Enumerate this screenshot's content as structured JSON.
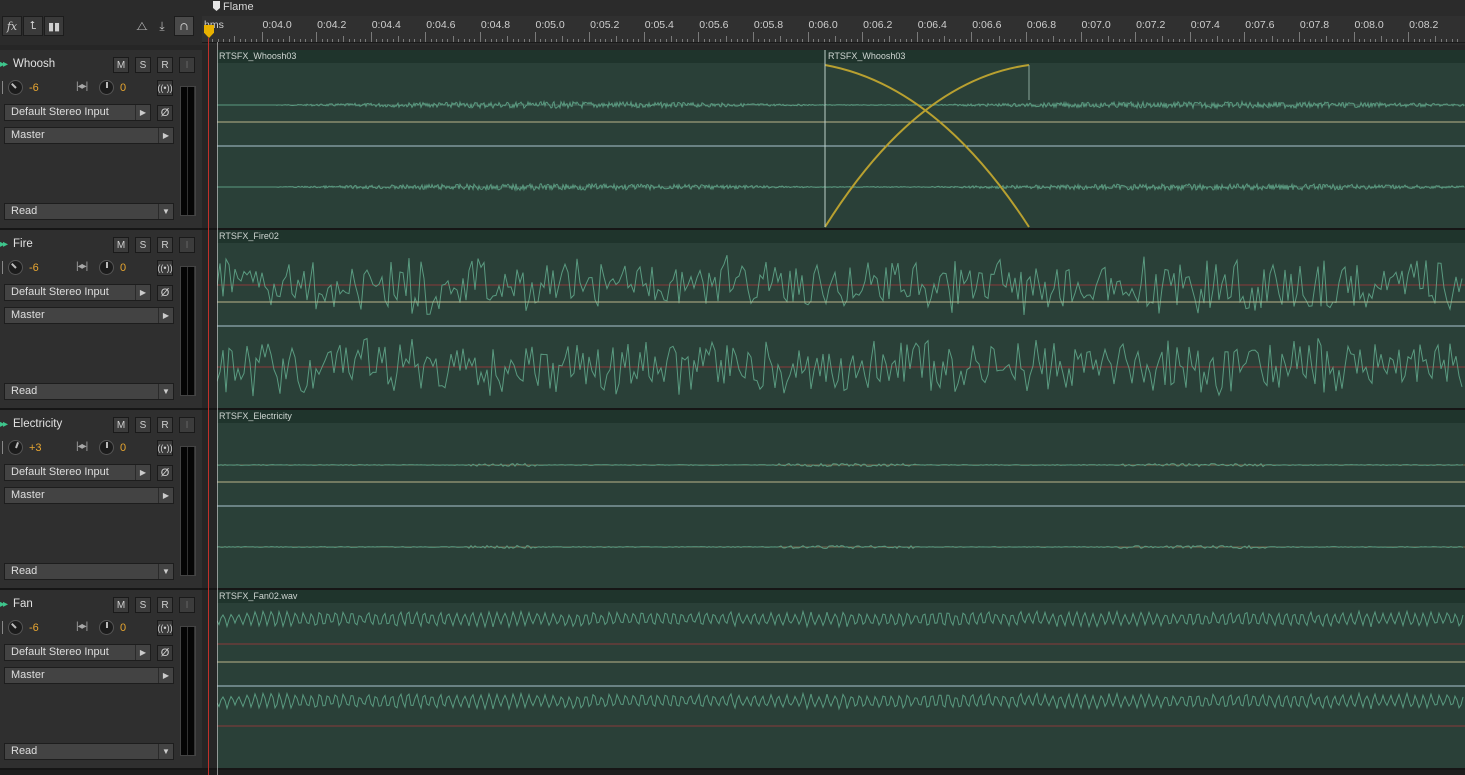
{
  "toolbar": {
    "fx_label": "fx",
    "icons": [
      "fx-button",
      "send-routing-icon",
      "eq-icon",
      "metronome-icon",
      "record-input-icon",
      "headphones-icon"
    ]
  },
  "marker": {
    "label": "Flame"
  },
  "ruler": {
    "unit_label": "hms",
    "ticks": [
      "0:04.0",
      "0:04.2",
      "0:04.4",
      "0:04.6",
      "0:04.8",
      "0:05.0",
      "0:05.2",
      "0:05.4",
      "0:05.6",
      "0:05.8",
      "0:06.0",
      "0:06.2",
      "0:06.4",
      "0:06.6",
      "0:06.8",
      "0:07.0",
      "0:07.2",
      "0:07.4",
      "0:07.6",
      "0:07.8",
      "0:08.0",
      "0:08.2"
    ]
  },
  "tracks": [
    {
      "name": "Whoosh",
      "m": "M",
      "s": "S",
      "r": "R",
      "i": "I",
      "volume": "-6",
      "pan": "0",
      "input": "Default Stereo Input",
      "output": "Master",
      "automation": "Read",
      "clips": [
        "RTSFX_Whoosh03",
        "RTSFX_Whoosh03"
      ]
    },
    {
      "name": "Fire",
      "m": "M",
      "s": "S",
      "r": "R",
      "i": "I",
      "volume": "-6",
      "pan": "0",
      "input": "Default Stereo Input",
      "output": "Master",
      "automation": "Read",
      "clips": [
        "RTSFX_Fire02"
      ]
    },
    {
      "name": "Electricity",
      "m": "M",
      "s": "S",
      "r": "R",
      "i": "I",
      "volume": "+3",
      "pan": "0",
      "input": "Default Stereo Input",
      "output": "Master",
      "automation": "Read",
      "clips": [
        "RTSFX_Electricity"
      ]
    },
    {
      "name": "Fan",
      "m": "M",
      "s": "S",
      "r": "R",
      "i": "I",
      "volume": "-6",
      "pan": "0",
      "input": "Default Stereo Input",
      "output": "Master",
      "automation": "Read",
      "clips": [
        "RTSFX_Fan02.wav"
      ]
    }
  ],
  "colors": {
    "clip_bg": "#2a4038",
    "waveform": "#5a9a80",
    "playhead": "#c0302a",
    "accent_value": "#e8a630",
    "fade_curve": "#b8a030",
    "volume_line": "#b9b48a",
    "pan_line": "#a9c4cf"
  }
}
